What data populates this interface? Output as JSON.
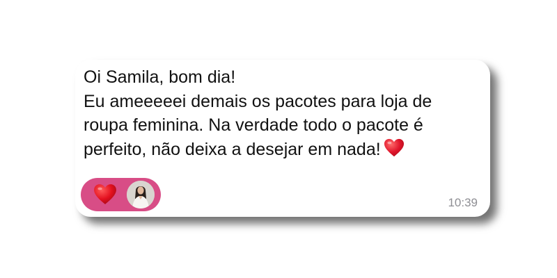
{
  "message": {
    "lines": [
      "Oi Samila, bom dia!",
      "Eu ameeeeei demais os pacotes para loja de",
      "roupa feminina. Na verdade todo o pacote é",
      "perfeito, não deixa a desejar em nada!"
    ],
    "trailing_emoji": "heart-emoji",
    "timestamp": "10:39"
  },
  "reaction": {
    "emoji": "heart-emoji",
    "reactor_avatar": "avatar"
  },
  "colors": {
    "bubble_bg": "#ffffff",
    "text": "#111111",
    "timestamp": "#8e8e93",
    "reaction_pill": "#d84d86",
    "heart": "#e0152b"
  }
}
